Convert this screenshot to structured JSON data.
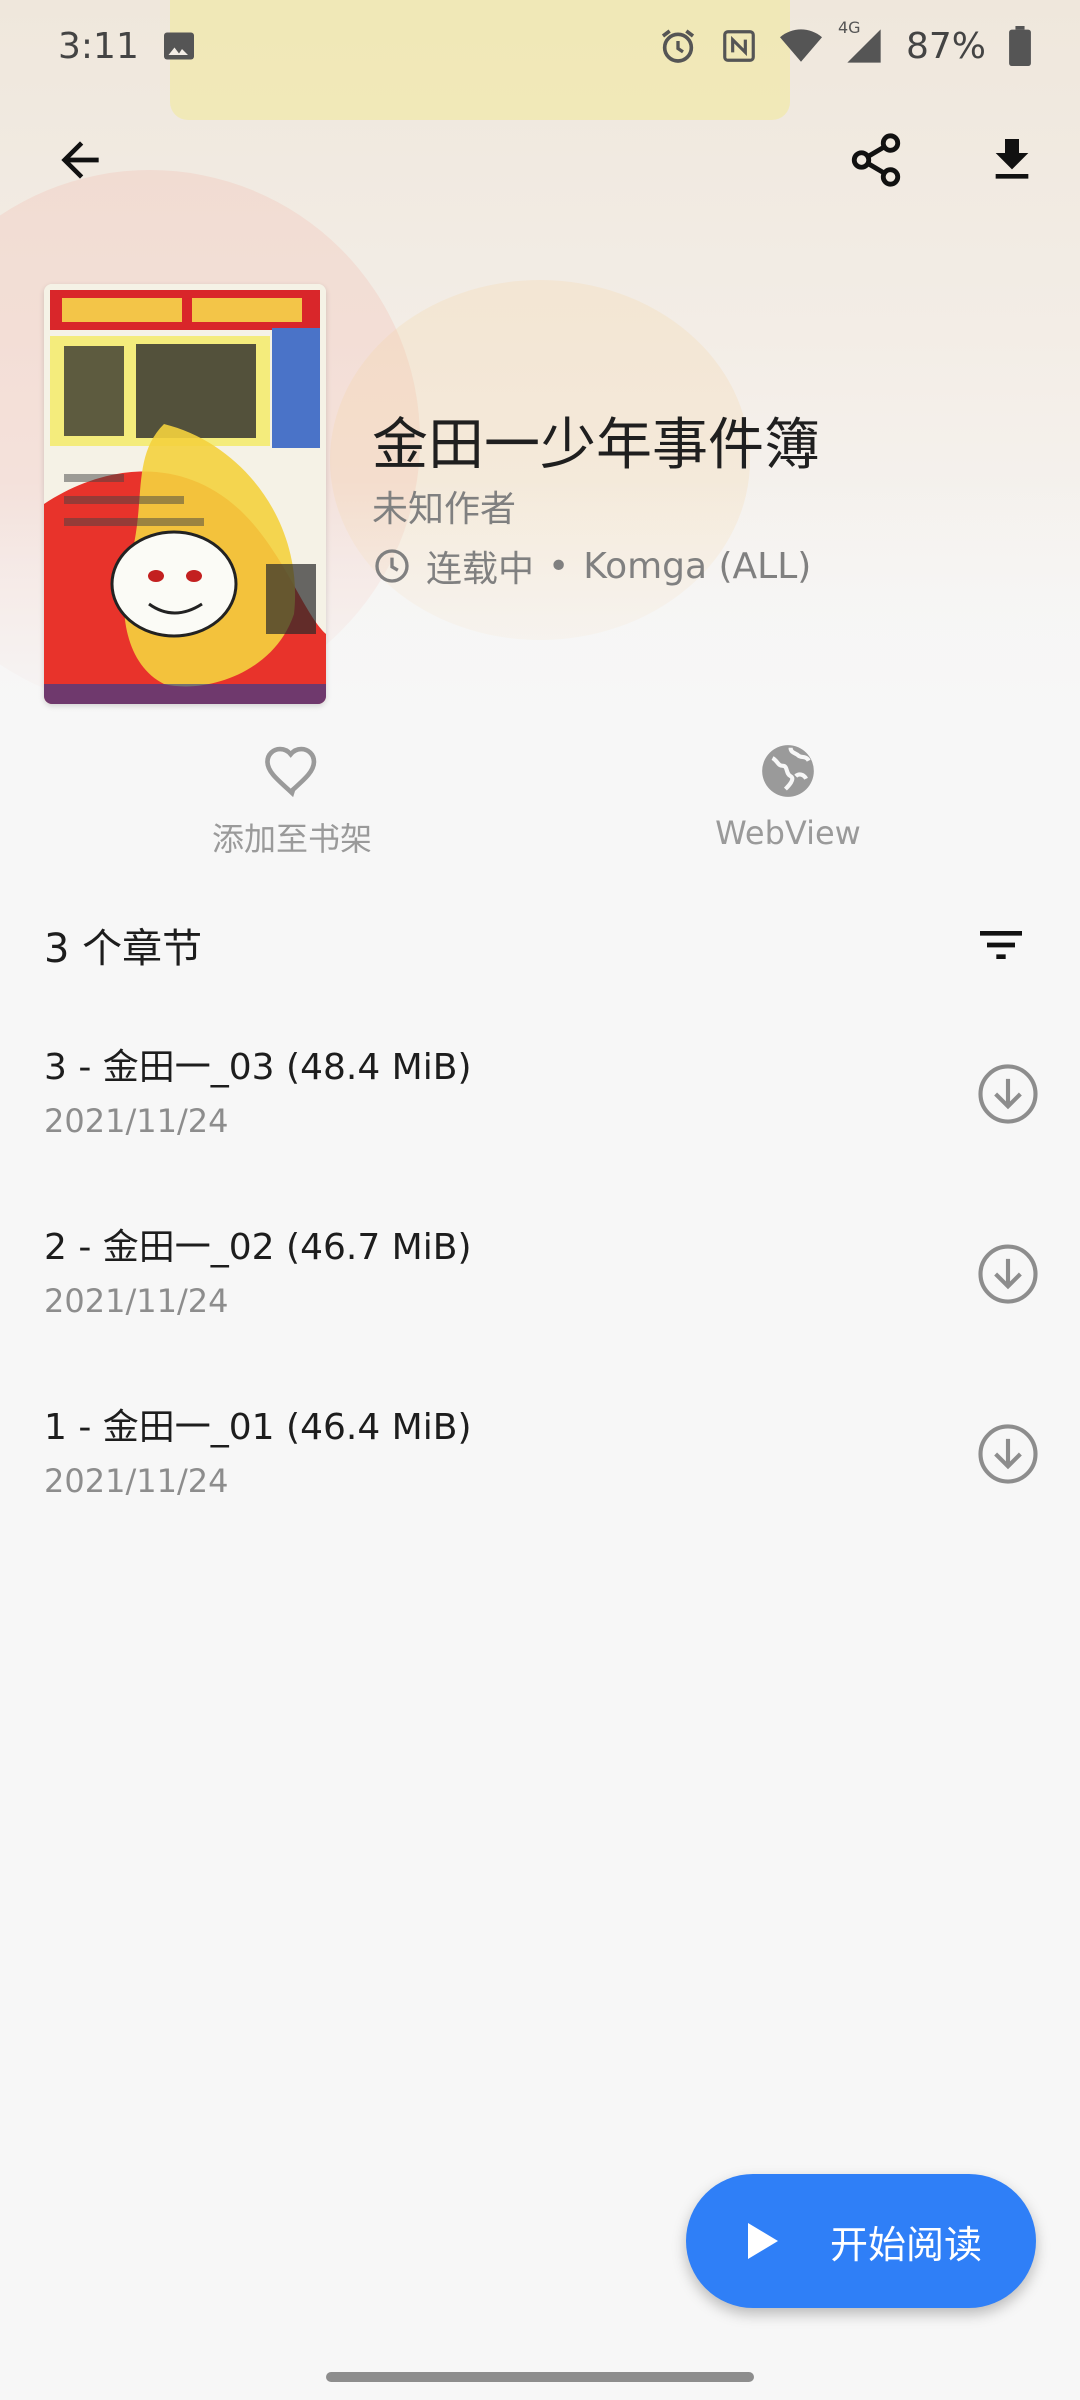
{
  "status_bar": {
    "time": "3:11",
    "battery_text": "87%",
    "network_label": "4G",
    "icons": [
      "image-icon",
      "alarm-icon",
      "nfc-icon",
      "wifi-icon",
      "cell-signal-icon",
      "battery-icon"
    ]
  },
  "toolbar": {
    "back_icon": "arrow-back-icon",
    "share_icon": "share-icon",
    "download_icon": "download-icon"
  },
  "manga": {
    "title": "金田一少年事件簿",
    "author": "未知作者",
    "status": "连载中",
    "separator": "•",
    "source": "Komga (ALL)"
  },
  "actions": {
    "favorite_label": "添加至书架",
    "webview_label": "WebView"
  },
  "chapters": {
    "count_label": "3 个章节",
    "items": [
      {
        "title": "3 - 金田一_03 (48.4 MiB)",
        "date": "2021/11/24"
      },
      {
        "title": "2 - 金田一_02 (46.7 MiB)",
        "date": "2021/11/24"
      },
      {
        "title": "1 - 金田一_01 (46.4 MiB)",
        "date": "2021/11/24"
      }
    ]
  },
  "fab": {
    "label": "开始阅读"
  },
  "colors": {
    "accent": "#2f7ff7",
    "background": "#f7f7f7",
    "secondary_text": "#808080"
  }
}
